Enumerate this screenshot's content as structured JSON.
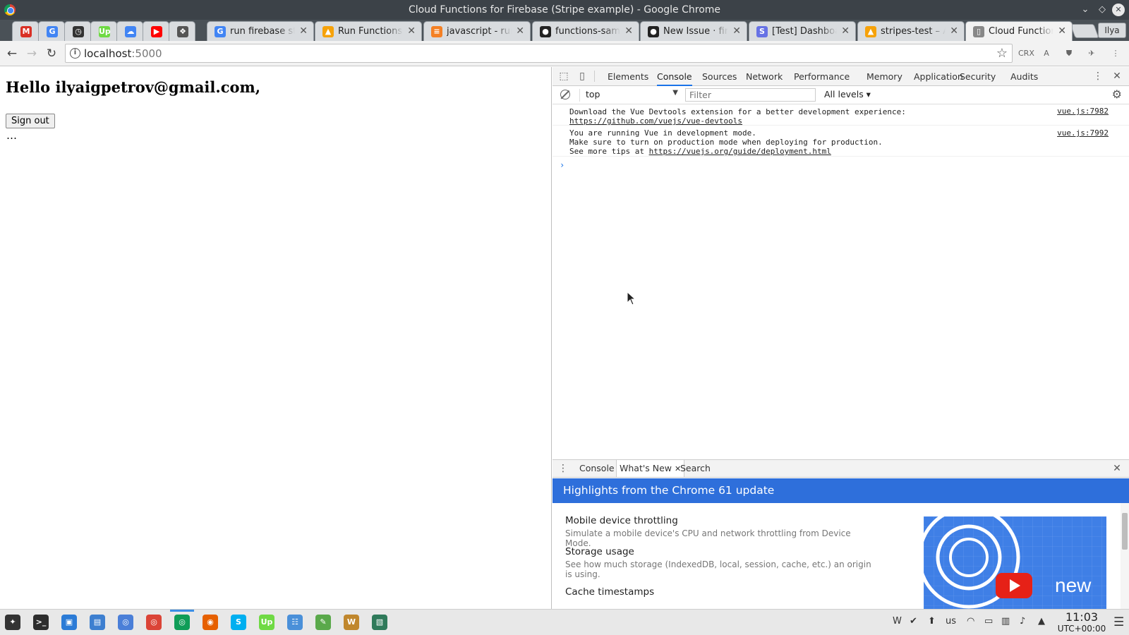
{
  "window": {
    "title": "Cloud Functions for Firebase (Stripe example) - Google Chrome",
    "controls": [
      "⌄",
      "◇",
      "✕"
    ]
  },
  "tabs": {
    "pinned": [
      {
        "icon": "gmail-icon",
        "glyph": "M",
        "color": "#d93025"
      },
      {
        "icon": "translate-icon",
        "glyph": "G",
        "color": "#4285f4"
      },
      {
        "icon": "timer-icon",
        "glyph": "◷",
        "color": "#333333"
      },
      {
        "icon": "upwork-icon",
        "glyph": "Up",
        "color": "#6fda44"
      },
      {
        "icon": "upload-icon",
        "glyph": "☁",
        "color": "#4285f4"
      },
      {
        "icon": "youtube-icon",
        "glyph": "▶",
        "color": "#ff0000"
      },
      {
        "icon": "puzzle-icon",
        "glyph": "❖",
        "color": "#555555"
      }
    ],
    "regular": [
      {
        "label": "run firebase stripe",
        "icon": "google-icon",
        "glyph": "G",
        "color": "#4285f4"
      },
      {
        "label": "Run Functions Locally",
        "icon": "firebase-icon",
        "glyph": "▲",
        "color": "#f6a20a"
      },
      {
        "label": "javascript - run firebase",
        "icon": "stackoverflow-icon",
        "glyph": "≡",
        "color": "#f48024"
      },
      {
        "label": "functions-samples",
        "icon": "github-icon",
        "glyph": "●",
        "color": "#222222"
      },
      {
        "label": "New Issue · firebase",
        "icon": "github-icon",
        "glyph": "●",
        "color": "#222222"
      },
      {
        "label": "[Test] Dashboard",
        "icon": "stripe-icon",
        "glyph": "S",
        "color": "#6772e5"
      },
      {
        "label": "stripes-test – Authentication",
        "icon": "firebase-icon",
        "glyph": "▲",
        "color": "#f6a20a"
      },
      {
        "label": "Cloud Functions for Firebase",
        "icon": "page-icon",
        "glyph": "▯",
        "color": "#888888",
        "active": true
      }
    ],
    "profile": "Ilya",
    "close_glyph": "✕"
  },
  "toolbar": {
    "back": "←",
    "forward": "→",
    "reload": "↻",
    "url_host": "localhost",
    "url_port": ":5000",
    "star": "☆",
    "extensions": [
      {
        "name": "crx-icon",
        "label": "CRX"
      },
      {
        "name": "translate-ext-icon",
        "label": "A"
      },
      {
        "name": "ublock-icon",
        "label": "⛊"
      },
      {
        "name": "extension-icon",
        "label": "✈"
      },
      {
        "name": "menu-icon",
        "label": "⋮"
      }
    ]
  },
  "page": {
    "greeting": "Hello ilyaigpetrov@gmail.com,",
    "sign_out": "Sign out",
    "ellipsis": "…"
  },
  "devtools": {
    "tabs": [
      "Elements",
      "Console",
      "Sources",
      "Network",
      "Performance",
      "Memory",
      "Application",
      "Security",
      "Audits"
    ],
    "active_tab": "Console",
    "context": "top",
    "filter_placeholder": "Filter",
    "levels": "All levels ▾",
    "console": [
      {
        "lines": [
          "Download the Vue Devtools extension for a better development experience:"
        ],
        "link": "https://github.com/vuejs/vue-devtools",
        "source": "vue.js:7982"
      },
      {
        "lines": [
          "You are running Vue in development mode.",
          "Make sure to turn on production mode when deploying for production."
        ],
        "prefix": "See more tips at ",
        "link": "https://vuejs.org/guide/deployment.html",
        "source": "vue.js:7992"
      }
    ],
    "prompt": "›",
    "drawer": {
      "tabs": [
        "Console",
        "What's New",
        "Search"
      ],
      "active": "What's New",
      "banner": "Highlights from the Chrome 61 update",
      "items": [
        {
          "title": "Mobile device throttling",
          "desc": "Simulate a mobile device's CPU and network throttling from Device Mode."
        },
        {
          "title": "Storage usage",
          "desc": "See how much storage (IndexedDB, local, session, cache, etc.) an origin is using."
        },
        {
          "title": "Cache timestamps",
          "desc": ""
        }
      ],
      "video_badge": "new"
    }
  },
  "taskbar": {
    "apps": [
      {
        "name": "app-launcher-icon",
        "glyph": "✦",
        "color": "#333333"
      },
      {
        "name": "terminal-icon",
        "glyph": ">_",
        "color": "#2d2d2d"
      },
      {
        "name": "store-icon",
        "glyph": "▣",
        "color": "#2b7bd6"
      },
      {
        "name": "files-icon",
        "glyph": "▤",
        "color": "#3d7fd0"
      },
      {
        "name": "chromium-icon",
        "glyph": "◎",
        "color": "#4a7fd8"
      },
      {
        "name": "chrome-icon",
        "glyph": "◎",
        "color": "#db4437"
      },
      {
        "name": "chrome-active-icon",
        "glyph": "◎",
        "color": "#0f9d58"
      },
      {
        "name": "firefox-icon",
        "glyph": "◉",
        "color": "#e66000"
      },
      {
        "name": "skype-icon",
        "glyph": "S",
        "color": "#00aff0"
      },
      {
        "name": "upwork-taskbar-icon",
        "glyph": "Up",
        "color": "#6fda44"
      },
      {
        "name": "chat-icon",
        "glyph": "☷",
        "color": "#4a90d9"
      },
      {
        "name": "editor-icon",
        "glyph": "✎",
        "color": "#5aa94b"
      },
      {
        "name": "word-icon",
        "glyph": "W",
        "color": "#c0872d"
      },
      {
        "name": "image-viewer-icon",
        "glyph": "▧",
        "color": "#2f7a5a"
      }
    ],
    "tray": [
      {
        "name": "tray-word-icon",
        "glyph": "W"
      },
      {
        "name": "tray-check-icon",
        "glyph": "✔"
      },
      {
        "name": "tray-update-icon",
        "glyph": "⬆"
      },
      {
        "name": "keyboard-layout",
        "glyph": "us"
      },
      {
        "name": "wifi-icon",
        "glyph": "◠"
      },
      {
        "name": "battery-icon",
        "glyph": "▭"
      },
      {
        "name": "clipboard-icon",
        "glyph": "▥"
      },
      {
        "name": "volume-icon",
        "glyph": "♪"
      },
      {
        "name": "tray-expand-icon",
        "glyph": "▲"
      }
    ],
    "time": "11:03",
    "timezone": "UTC+00:00",
    "menu": "☰"
  }
}
